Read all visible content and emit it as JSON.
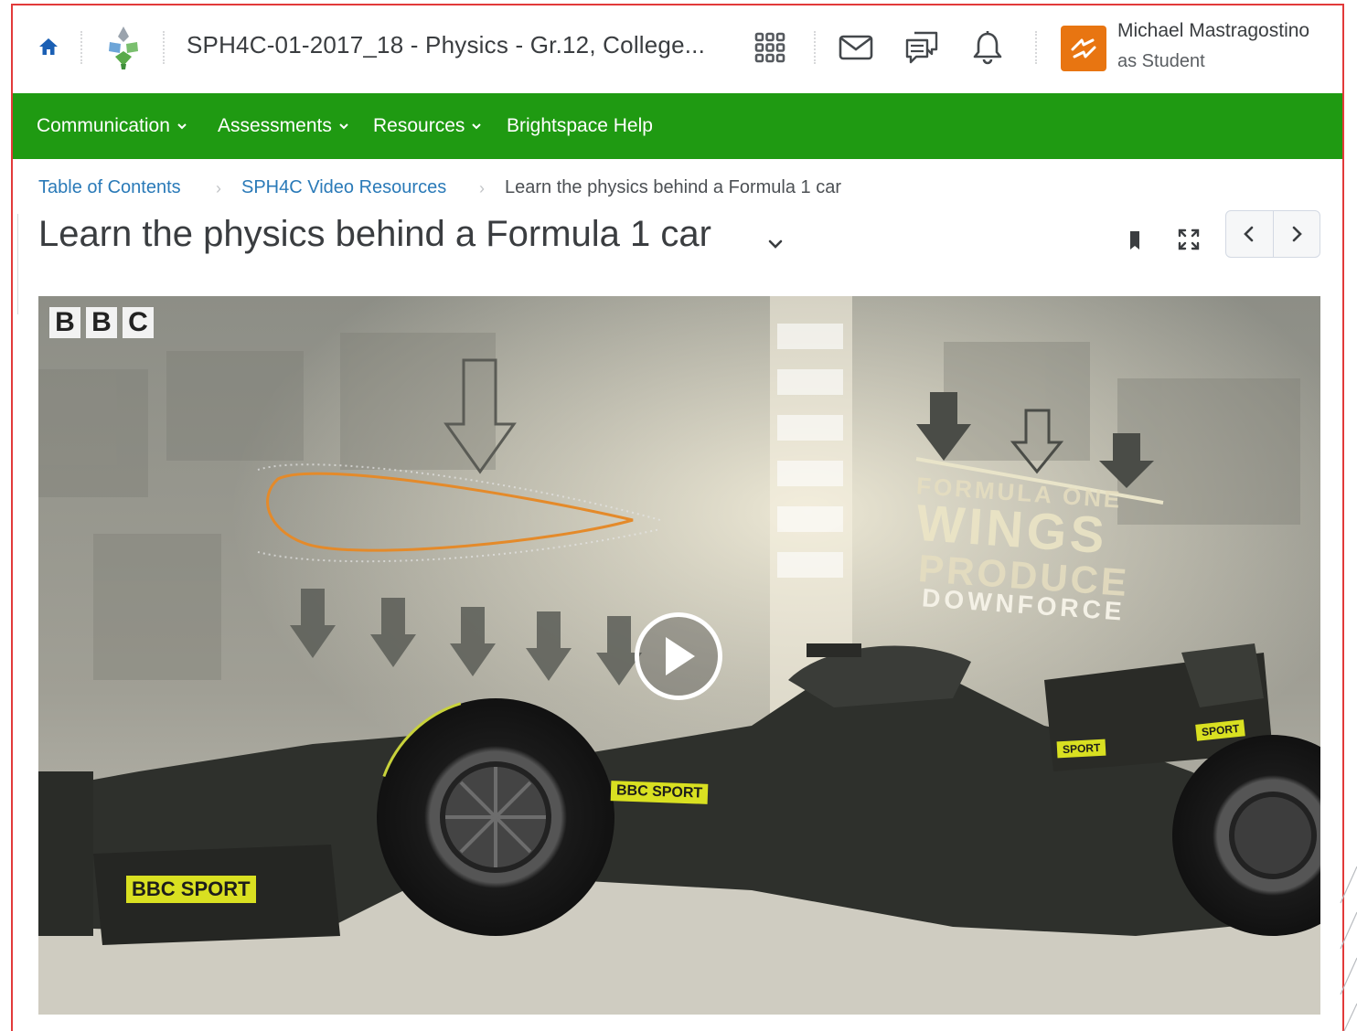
{
  "header": {
    "course_title": "SPH4C-01-2017_18 - Physics - Gr.12, College...",
    "user_name": "Michael Mastragostino",
    "user_role": "as Student",
    "icons": [
      "home-icon",
      "org-logo-icon",
      "waffle-icon",
      "mail-icon",
      "chat-icon",
      "bell-icon",
      "avatar-icon"
    ]
  },
  "nav": {
    "items": [
      {
        "label": "Communication",
        "has_menu": true
      },
      {
        "label": "Assessments",
        "has_menu": true
      },
      {
        "label": "Resources",
        "has_menu": true
      },
      {
        "label": "Brightspace Help",
        "has_menu": false
      }
    ],
    "color": "#1f9a12"
  },
  "breadcrumb": {
    "items": [
      "Table of Contents",
      "SPH4C Video Resources"
    ],
    "current": "Learn the physics behind a Formula 1 car"
  },
  "page": {
    "title": "Learn the physics behind a Formula 1 car"
  },
  "video": {
    "logo": [
      "B",
      "B",
      "C"
    ],
    "overlay_lines": [
      "FORMULA ONE",
      "WINGS",
      "PRODUCE",
      "DOWNFORCE"
    ],
    "sponsor_label": "BBC SPORT",
    "sponsor_short": "SPORT"
  },
  "colors": {
    "accent": "#1f9a12",
    "link": "#2a7ab8",
    "avatar": "#e87511",
    "frame_border": "#e23a3a"
  }
}
